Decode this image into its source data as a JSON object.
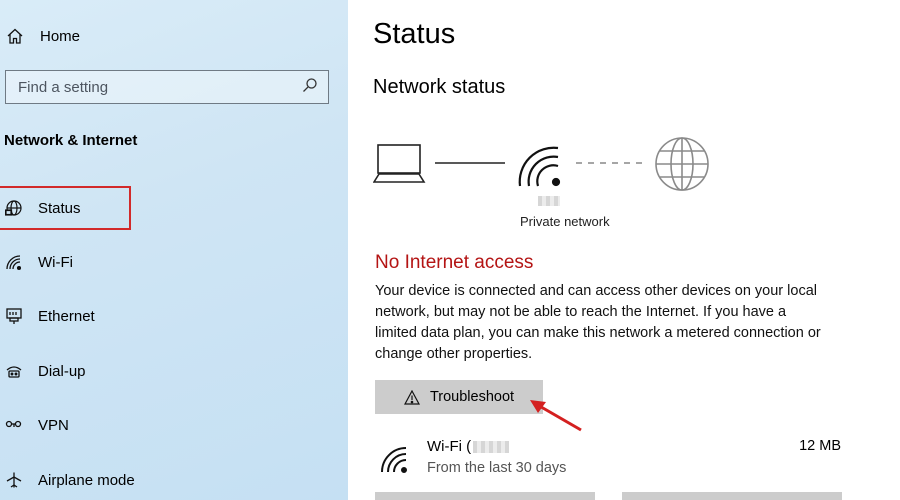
{
  "sidebar": {
    "home_label": "Home",
    "search_placeholder": "Find a setting",
    "section_title": "Network & Internet",
    "items": [
      {
        "label": "Status",
        "icon": "globe-status-icon"
      },
      {
        "label": "Wi-Fi",
        "icon": "wifi-icon"
      },
      {
        "label": "Ethernet",
        "icon": "ethernet-icon"
      },
      {
        "label": "Dial-up",
        "icon": "dial-up-icon"
      },
      {
        "label": "VPN",
        "icon": "vpn-icon"
      },
      {
        "label": "Airplane mode",
        "icon": "airplane-icon"
      }
    ],
    "active_item": "Status"
  },
  "main": {
    "title": "Status",
    "subtitle": "Network status",
    "network_name": "Private network",
    "connection_state": "No Internet access",
    "description": "Your device is connected and can access other devices on your local network, but may not be able to reach the Internet. If you have a limited data plan, you can make this network a metered connection or change other properties.",
    "troubleshoot_label": "Troubleshoot",
    "wifi": {
      "name": "Wi-Fi (",
      "period": "From the last 30 days",
      "usage": "12 MB"
    }
  },
  "colors": {
    "accent_red": "#b41414",
    "highlight_box": "#d22a2a",
    "button_gray": "#cccccc"
  }
}
